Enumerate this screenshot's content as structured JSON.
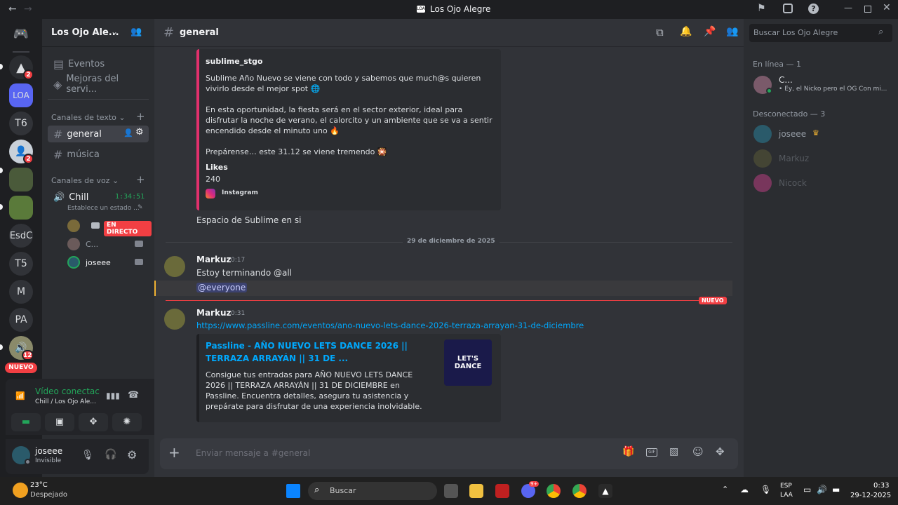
{
  "window": {
    "title": "Los Ojo Alegre"
  },
  "servers": {
    "items": [
      {
        "label": "",
        "badge": "2"
      },
      {
        "label": "LOA",
        "badge": ""
      },
      {
        "label": "T6",
        "badge": ""
      },
      {
        "label": "",
        "badge": "2"
      },
      {
        "label": "",
        "badge": ""
      },
      {
        "label": "",
        "badge": ""
      },
      {
        "label": "EsdC",
        "badge": ""
      },
      {
        "label": "T5",
        "badge": ""
      },
      {
        "label": "M",
        "badge": ""
      },
      {
        "label": "PA",
        "badge": ""
      },
      {
        "label": "",
        "badge": "12"
      }
    ],
    "new_label": "NUEVO"
  },
  "sidebar": {
    "server_name": "Los Ojo Ale...",
    "events": "Eventos",
    "boosts": "Mejoras del servi...",
    "text_category": "Canales de texto",
    "text_channels": [
      "general",
      "música"
    ],
    "voice_category": "Canales de voz",
    "voice_channel": "Chill",
    "voice_timer": "1:34:51",
    "voice_status": "Establece un estado ...",
    "voice_users": [
      {
        "name": "",
        "live": "EN DIRECTO"
      },
      {
        "name": "C..."
      },
      {
        "name": "joseee"
      }
    ],
    "connection": {
      "title": "Vídeo conectac",
      "subtitle": "Chill / Los Ojo Ale..."
    },
    "user": {
      "name": "joseee",
      "status": "Invisible"
    }
  },
  "header": {
    "channel": "general",
    "search_placeholder": "Buscar Los Ojo Alegre"
  },
  "chat": {
    "embed1": {
      "author": "sublime_stgo",
      "p1": "Sublime Año Nuevo se viene con todo y sabemos que much@s quieren vivirlo desde el mejor spot 🌐",
      "p2": "En esta oportunidad, la fiesta será en el sector exterior, ideal para disfrutar la noche de verano, el calorcito y un ambiente que se va a sentir encendido desde el minuto uno 🔥",
      "p3": "Prepárense… este 31.12 se viene tremendo 🎇",
      "likes_label": "Likes",
      "likes": "240",
      "footer": "Instagram"
    },
    "msg0": "Espacio de Sublime en si",
    "divider": "29 de diciembre de 2025",
    "m1": {
      "author": "Markuz",
      "time": "0:17",
      "text": "Estoy terminando @all",
      "mention": "@everyone"
    },
    "new_badge": "NUEVO",
    "m2": {
      "author": "Markuz",
      "time": "0:31",
      "link": "https://www.passline.com/eventos/ano-nuevo-lets-dance-2026-terraza-arrayan-31-de-diciembre"
    },
    "embed2": {
      "title": "Passline - AÑO NUEVO LETS DANCE 2026 || TERRAZA ARRAYÁN || 31 DE ...",
      "desc": "Consigue tus entradas para AÑO NUEVO LETS DANCE 2026 || TERRAZA ARRAYÁN || 31 DE DICIEMBRE en Passline. Encuentra detalles, asegura tu asistencia y prepárate para disfrutar de una experiencia inolvidable.",
      "thumb_text": "LET'S DANCE"
    },
    "input_placeholder": "Enviar mensaje a #general"
  },
  "members": {
    "online_header": "En línea — 1",
    "online": [
      {
        "name": "C...",
        "activity": "• Ey, el Nicko pero el OG Con mi..."
      }
    ],
    "offline_header": "Desconectado — 3",
    "offline": [
      {
        "name": "joseee"
      },
      {
        "name": "Markuz"
      },
      {
        "name": "Nicock"
      }
    ]
  },
  "taskbar": {
    "weather_temp": "23°C",
    "weather_desc": "Despejado",
    "search": "Buscar",
    "lang1": "ESP",
    "lang2": "LAA",
    "time": "0:33",
    "date": "29-12-2025",
    "discord_badge": "9+"
  },
  "colors": {
    "accent": "#5865f2",
    "link": "#00a8fc",
    "online": "#23a55a",
    "red": "#f23f43"
  }
}
